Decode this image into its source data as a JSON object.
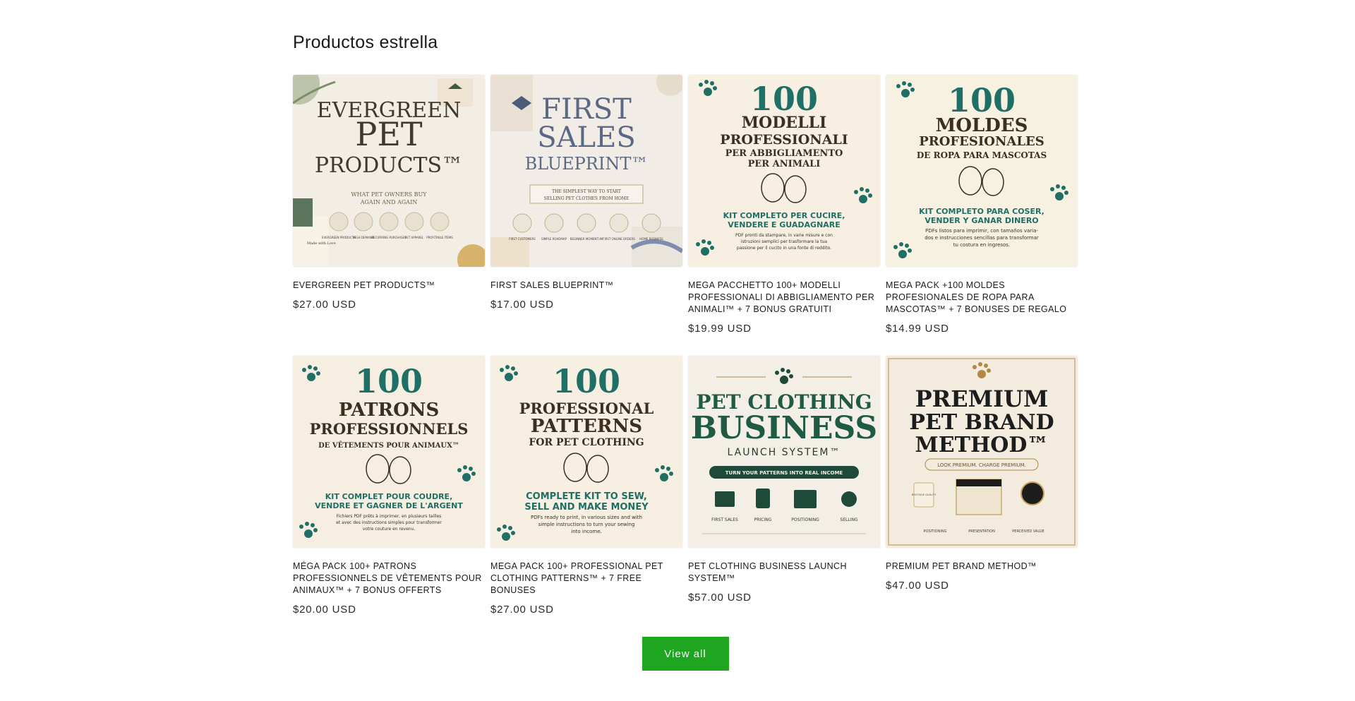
{
  "section_title": "Productos estrella",
  "view_all_label": "View all",
  "products": [
    {
      "title": "EVERGREEN PET PRODUCTS™",
      "price": "$27.00 USD",
      "art": {
        "line1": "EVERGREEN",
        "line2": "PET",
        "line3": "PRODUCTS™",
        "sub1": "WHAT PET OWNERS BUY",
        "sub2": "AGAIN AND AGAIN",
        "icons": [
          "EVERGREEN PRODUCTS",
          "HIGH DEMAND",
          "RECURRING PURCHASES",
          "PET APPAREL",
          "PROFITABLE ITEMS"
        ],
        "ribbon": "Made with Love"
      }
    },
    {
      "title": "FIRST SALES BLUEPRINT™",
      "price": "$17.00 USD",
      "art": {
        "line1": "FIRST",
        "line2": "SALES",
        "line3": "BLUEPRINT™",
        "sub1": "THE SIMPLEST WAY TO START",
        "sub2": "SELLING PET CLOTHES FROM HOME",
        "icons": [
          "FIRST CUSTOMERS",
          "SIMPLE ROADMAP",
          "BEGINNER MOMENTUM",
          "FIRST ONLINE ORDERS",
          "HOME BUSINESS"
        ]
      }
    },
    {
      "title": "MEGA PACCHETTO 100+ MODELLI PROFESSIONALI DI ABBIGLIAMENTO PER ANIMALI™ + 7 BONUS GRATUITI",
      "price": "$19.99 USD",
      "art": {
        "big": "100",
        "l1": "MODELLI",
        "l2": "PROFESSIONALI",
        "l3": "PER ABBIGLIAMENTO",
        "l4": "PER ANIMALI",
        "g1": "KIT COMPLETO PER CUCIRE,",
        "g2": "VENDERE E GUADAGNARE",
        "s1": "PDF pronti da stampare, in varie misure e con",
        "s2": "istruzioni semplici per trasformare la tua",
        "s3": "passione per il cucito in una fonte di reddito."
      }
    },
    {
      "title": "MEGA PACK +100 MOLDES PROFESIONALES DE ROPA PARA MASCOTAS™ + 7 BONUSES DE REGALO",
      "price": "$14.99 USD",
      "art": {
        "big": "100",
        "l1": "MOLDES",
        "l2": "PROFESIONALES",
        "l3": "DE ROPA PARA MASCOTAS",
        "l4": "",
        "g1": "KIT COMPLETO PARA COSER,",
        "g2": "VENDER Y GANAR DINERO",
        "s1": "PDFs listos para imprimir, con tamaños varia-",
        "s2": "dos e instrucciones sencillas para transformar",
        "s3": "tu costura en ingresos."
      }
    },
    {
      "title": "MÉGA PACK 100+ PATRONS PROFESSIONNELS DE VÊTEMENTS POUR ANIMAUX™ + 7 BONUS OFFERTS",
      "price": "$20.00 USD",
      "art": {
        "big": "100",
        "l1": "PATRONS",
        "l2": "PROFESSIONNELS",
        "l3": "DE VÊTEMENTS POUR ANIMAUX™",
        "l4": "",
        "g1": "KIT COMPLET POUR COUDRE,",
        "g2": "VENDRE ET GAGNER DE L'ARGENT",
        "s1": "Fichiers PDF prêts à imprimer, en plusieurs tailles",
        "s2": "et avec des instructions simples pour transformer",
        "s3": "votre couture en revenu."
      }
    },
    {
      "title": "MEGA PACK 100+ PROFESSIONAL PET CLOTHING PATTERNS™ + 7 FREE BONUSES",
      "price": "$27.00 USD",
      "art": {
        "big": "100",
        "l1": "PROFESSIONAL",
        "l2": "PATTERNS",
        "l3": "FOR PET CLOTHING",
        "l4": "",
        "g1": "COMPLETE KIT TO SEW,",
        "g2": "SELL AND MAKE MONEY",
        "s1": "PDFs ready to print, in various sizes and with",
        "s2": "simple instructions to turn your sewing",
        "s3": "into income."
      }
    },
    {
      "title": "PET CLOTHING BUSINESS LAUNCH SYSTEM™",
      "price": "$57.00 USD",
      "art": {
        "l1": "PET CLOTHING",
        "l2": "BUSINESS",
        "l3": "LAUNCH SYSTEM™",
        "banner": "TURN YOUR PATTERNS INTO REAL INCOME",
        "icons": [
          "FIRST SALES",
          "PRICING",
          "POSITIONING",
          "SELLING"
        ]
      }
    },
    {
      "title": "PREMIUM PET BRAND METHOD™",
      "price": "$47.00 USD",
      "art": {
        "l1": "PREMIUM",
        "l2": "PET BRAND",
        "l3": "METHOD™",
        "tag": "LOOK PREMIUM. CHARGE PREMIUM.",
        "icons": [
          "POSITIONING",
          "PRESENTATION",
          "PERCEIVED VALUE"
        ],
        "hangtag": "BOUTIQUE QUALITY"
      }
    }
  ],
  "colors": {
    "button": "#1ea620",
    "cream": "#f6efe2",
    "teal": "#1f6f66",
    "brown": "#3d2e22",
    "gold": "#b08a45",
    "slate": "#5d6b85"
  }
}
